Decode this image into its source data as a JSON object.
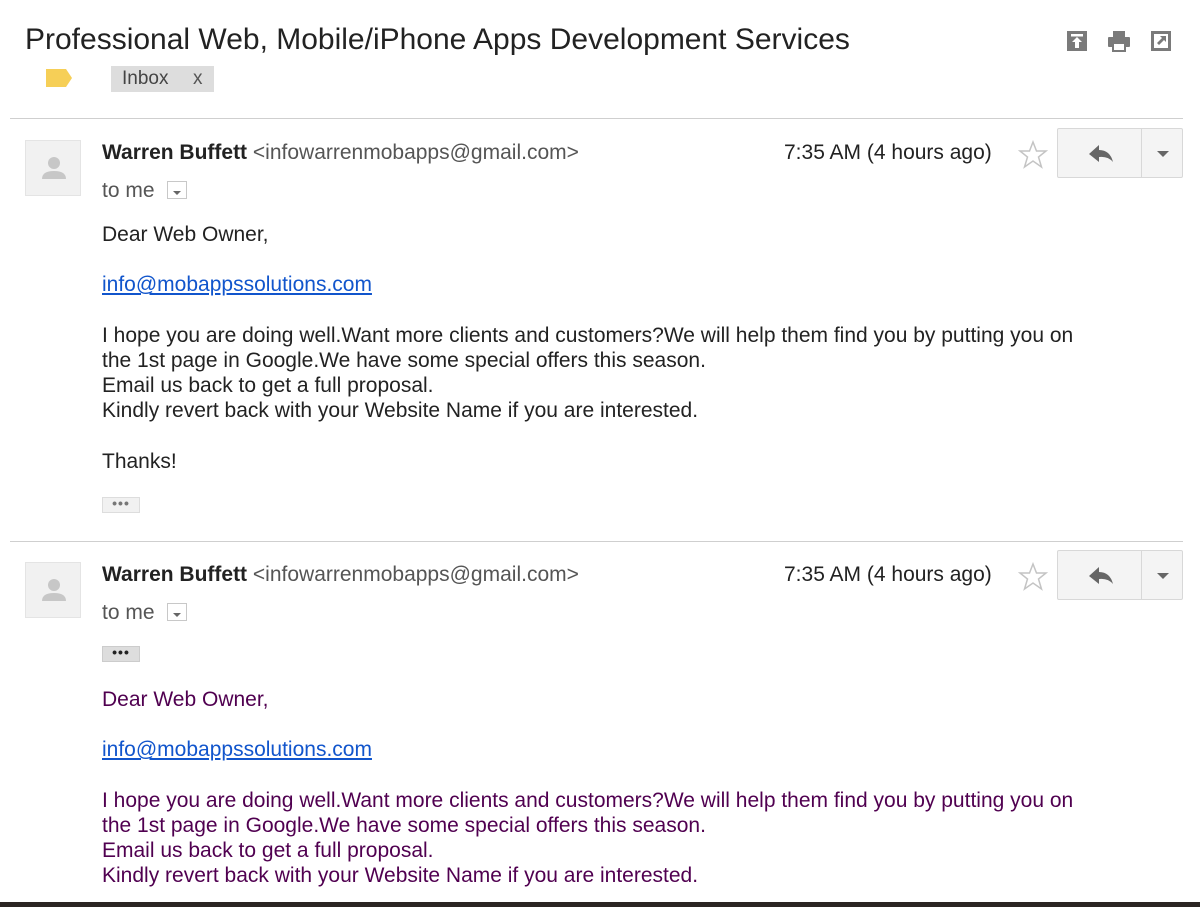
{
  "thread": {
    "subject": "Professional Web, Mobile/iPhone Apps Development Services",
    "labels": [
      {
        "name": "Inbox",
        "remove_label": "x"
      }
    ],
    "actions": {
      "archive_icon": "archive-icon",
      "print_icon": "print-icon",
      "new_window_icon": "new-window-icon"
    }
  },
  "messages": [
    {
      "sender_name": "Warren Buffett",
      "sender_email": "<infowarrenmobapps@gmail.com>",
      "time": "7:35 AM (4 hours ago)",
      "recipient": "to me",
      "greeting": "Dear Web Owner,",
      "link": "info@mobappssolutions.com",
      "lines": [
        "I hope you are doing well.Want more clients and customers?We will help them find you by putting you on",
        "the 1st page in Google.We have some special offers this season.",
        "Email us back to get a full proposal.",
        "Kindly revert back with your Website Name if you are interested."
      ],
      "closing": "Thanks!",
      "trimmed_toggle": "•••"
    },
    {
      "sender_name": "Warren Buffett",
      "sender_email": "<infowarrenmobapps@gmail.com>",
      "time": "7:35 AM (4 hours ago)",
      "recipient": "to me",
      "trimmed_toggle": "•••",
      "greeting": "Dear Web Owner,",
      "link": "info@mobappssolutions.com",
      "lines": [
        "I hope you are doing well.Want more clients and customers?We will help them find you by putting you on",
        "the 1st page in Google.We have some special offers this season.",
        "Email us back to get a full proposal.",
        "Kindly revert back with your Website Name if you are interested."
      ]
    }
  ],
  "colors": {
    "link": "#1155cc",
    "quoted_text": "#500050",
    "label_tag": "#f6cf57",
    "icon_gray": "#777777"
  }
}
